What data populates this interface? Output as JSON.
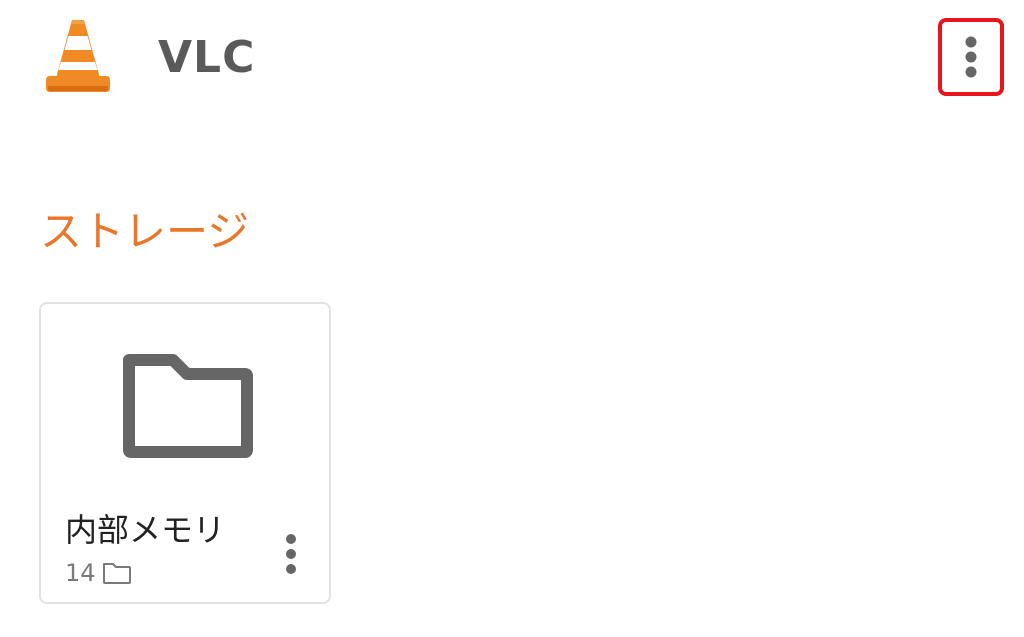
{
  "toolbar": {
    "app_title": "VLC",
    "logo_icon": "vlc-cone-icon",
    "overflow_icon": "more-vertical-icon",
    "highlight_color": "#e8131b"
  },
  "storage": {
    "section_title": "ストレージ",
    "accent_color": "#e8762b",
    "items": [
      {
        "title": "内部メモリ",
        "folder_count": "14",
        "icon": "folder-icon",
        "meta_icon": "folder-outline-icon",
        "more_icon": "more-vertical-icon"
      }
    ]
  }
}
